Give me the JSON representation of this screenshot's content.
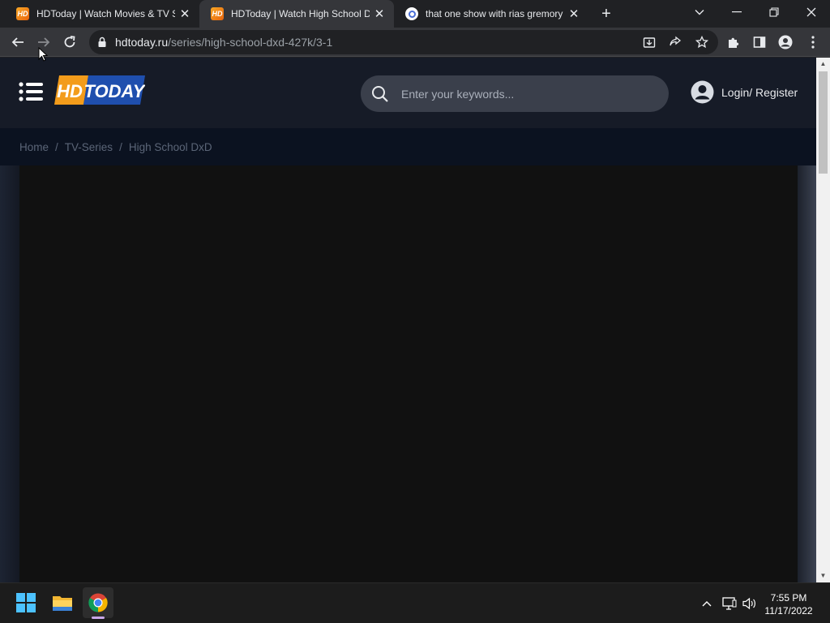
{
  "browser": {
    "tabs": [
      {
        "title": "HDToday | Watch Movies & TV Series",
        "favicon": "hdtoday-favicon-icon",
        "active": false
      },
      {
        "title": "HDToday | Watch High School DxD",
        "favicon": "hdtoday-favicon-icon",
        "active": true
      },
      {
        "title": "that one show with rias gremory",
        "favicon": "search-favicon-icon",
        "active": false
      }
    ],
    "favicon_text": "HD",
    "url": {
      "host": "hdtoday.ru",
      "path": "/series/high-school-dxd-427k/3-1"
    }
  },
  "site": {
    "logo": {
      "left": "HD",
      "right": "TODAY"
    },
    "search": {
      "placeholder": "Enter your keywords..."
    },
    "login_label": "Login/ Register",
    "breadcrumb": [
      "Home",
      "TV-Series",
      "High School DxD"
    ],
    "breadcrumb_separator": "/"
  },
  "taskbar": {
    "time": "7:55 PM",
    "date": "11/17/2022"
  },
  "colors": {
    "brand_orange": "#f39c1b",
    "brand_blue": "#1f4fae",
    "header_bg": "#161b27",
    "player_bg": "#111111"
  }
}
